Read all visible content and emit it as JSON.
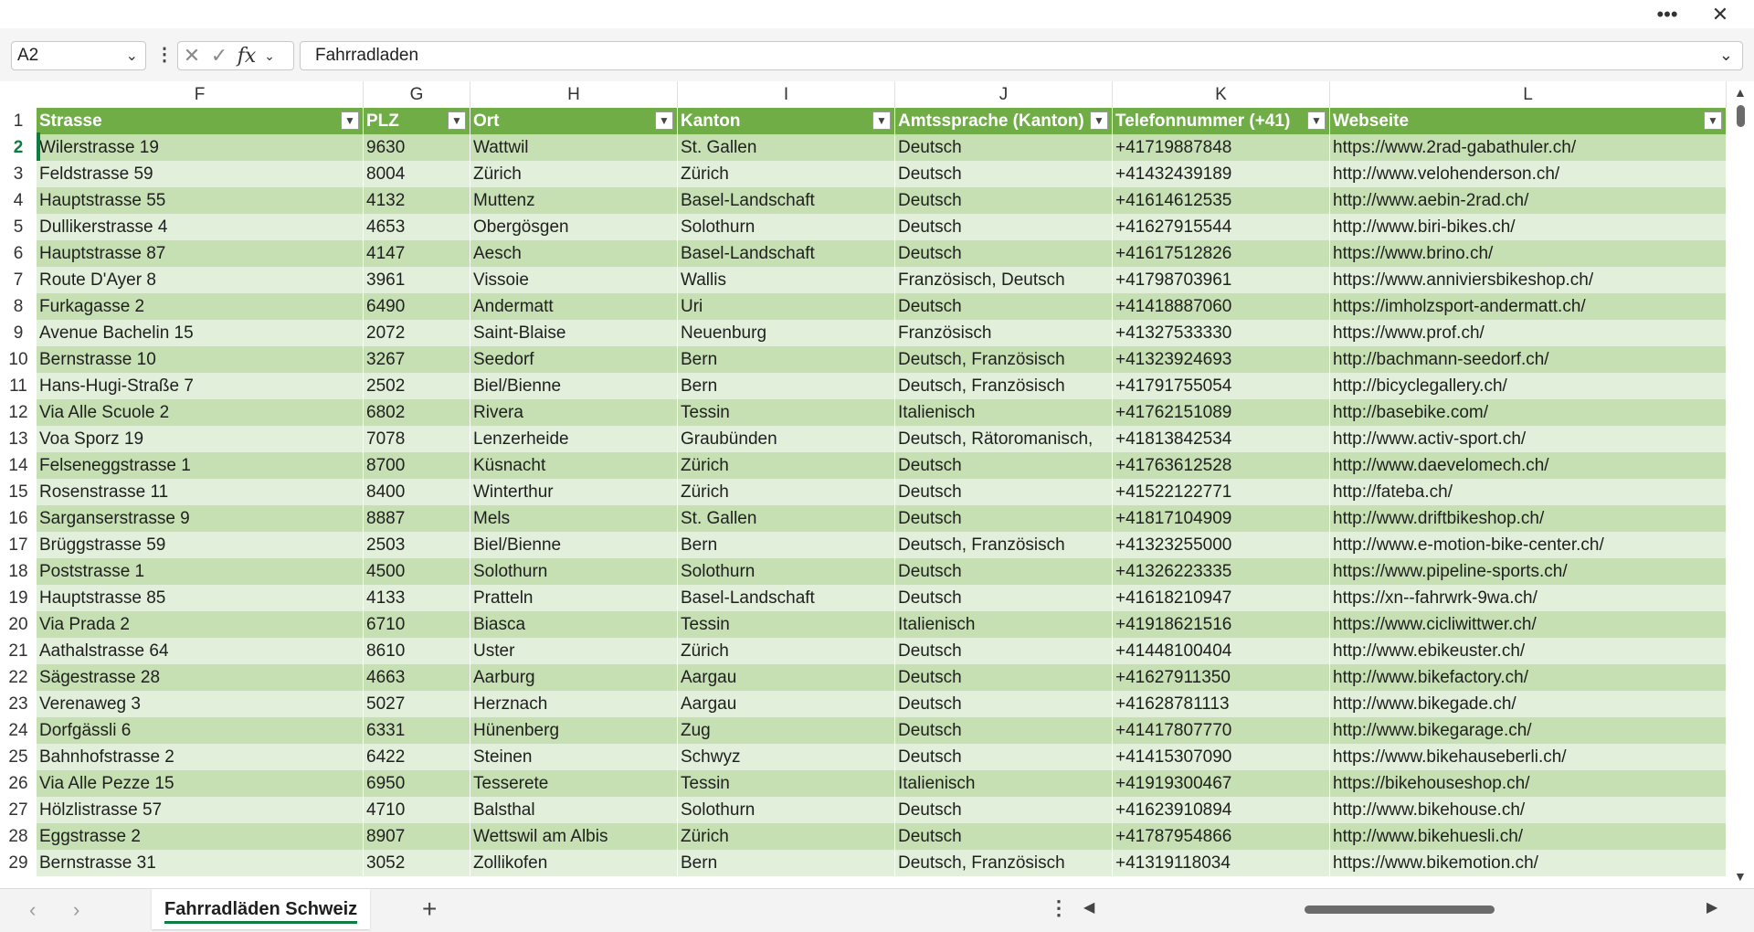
{
  "window": {
    "more_glyph": "•••",
    "close_glyph": "✕"
  },
  "formula_bar": {
    "name_box": "A2",
    "cancel_glyph": "✕",
    "enter_glyph": "✓",
    "fx_label": "fx",
    "content": "Fahrradladen"
  },
  "columns": [
    "F",
    "G",
    "H",
    "I",
    "J",
    "K",
    "L"
  ],
  "header_row_number": "1",
  "headers": [
    "Strasse",
    "PLZ",
    "Ort",
    "Kanton",
    "Amtssprache (Kanton)",
    "Telefonnummer (+41)",
    "Webseite"
  ],
  "rows": [
    {
      "n": "2",
      "c": [
        "Wilerstrasse 19",
        "9630",
        "Wattwil",
        "St. Gallen",
        "Deutsch",
        "+41719887848",
        "https://www.2rad-gabathuler.ch/"
      ]
    },
    {
      "n": "3",
      "c": [
        "Feldstrasse 59",
        "8004",
        "Zürich",
        "Zürich",
        "Deutsch",
        "+41432439189",
        "http://www.velohenderson.ch/"
      ]
    },
    {
      "n": "4",
      "c": [
        "Hauptstrasse 55",
        "4132",
        "Muttenz",
        "Basel-Landschaft",
        "Deutsch",
        "+41614612535",
        "http://www.aebin-2rad.ch/"
      ]
    },
    {
      "n": "5",
      "c": [
        "Dullikerstrasse 4",
        "4653",
        "Obergösgen",
        "Solothurn",
        "Deutsch",
        "+41627915544",
        "http://www.biri-bikes.ch/"
      ]
    },
    {
      "n": "6",
      "c": [
        "Hauptstrasse 87",
        "4147",
        "Aesch",
        "Basel-Landschaft",
        "Deutsch",
        "+41617512826",
        "https://www.brino.ch/"
      ]
    },
    {
      "n": "7",
      "c": [
        "Route D'Ayer 8",
        "3961",
        "Vissoie",
        "Wallis",
        "Französisch, Deutsch",
        "+41798703961",
        "https://www.anniviersbikeshop.ch/"
      ]
    },
    {
      "n": "8",
      "c": [
        "Furkagasse 2",
        "6490",
        "Andermatt",
        "Uri",
        "Deutsch",
        "+41418887060",
        "https://imholzsport-andermatt.ch/"
      ]
    },
    {
      "n": "9",
      "c": [
        "Avenue Bachelin 15",
        "2072",
        "Saint-Blaise",
        "Neuenburg",
        "Französisch",
        "+41327533330",
        "https://www.prof.ch/"
      ]
    },
    {
      "n": "10",
      "c": [
        "Bernstrasse 10",
        "3267",
        "Seedorf",
        "Bern",
        "Deutsch, Französisch",
        "+41323924693",
        "http://bachmann-seedorf.ch/"
      ]
    },
    {
      "n": "11",
      "c": [
        "Hans-Hugi-Straße 7",
        "2502",
        "Biel/Bienne",
        "Bern",
        "Deutsch, Französisch",
        "+41791755054",
        "http://bicyclegallery.ch/"
      ]
    },
    {
      "n": "12",
      "c": [
        "Via Alle Scuole 2",
        "6802",
        "Rivera",
        "Tessin",
        "Italienisch",
        "+41762151089",
        "http://basebike.com/"
      ]
    },
    {
      "n": "13",
      "c": [
        "Voa Sporz 19",
        "7078",
        "Lenzerheide",
        "Graubünden",
        "Deutsch, Rätoromanisch,",
        "+41813842534",
        "http://www.activ-sport.ch/"
      ]
    },
    {
      "n": "14",
      "c": [
        "Felseneggstrasse 1",
        "8700",
        "Küsnacht",
        "Zürich",
        "Deutsch",
        "+41763612528",
        "http://www.daevelomech.ch/"
      ]
    },
    {
      "n": "15",
      "c": [
        "Rosenstrasse 11",
        "8400",
        "Winterthur",
        "Zürich",
        "Deutsch",
        "+41522122771",
        "http://fateba.ch/"
      ]
    },
    {
      "n": "16",
      "c": [
        "Sarganserstrasse 9",
        "8887",
        "Mels",
        "St. Gallen",
        "Deutsch",
        "+41817104909",
        "http://www.driftbikeshop.ch/"
      ]
    },
    {
      "n": "17",
      "c": [
        "Brüggstrasse 59",
        "2503",
        "Biel/Bienne",
        "Bern",
        "Deutsch, Französisch",
        "+41323255000",
        "http://www.e-motion-bike-center.ch/"
      ]
    },
    {
      "n": "18",
      "c": [
        "Poststrasse 1",
        "4500",
        "Solothurn",
        "Solothurn",
        "Deutsch",
        "+41326223335",
        "https://www.pipeline-sports.ch/"
      ]
    },
    {
      "n": "19",
      "c": [
        "Hauptstrasse 85",
        "4133",
        "Pratteln",
        "Basel-Landschaft",
        "Deutsch",
        "+41618210947",
        "https://xn--fahrwrk-9wa.ch/"
      ]
    },
    {
      "n": "20",
      "c": [
        "Via Prada 2",
        "6710",
        "Biasca",
        "Tessin",
        "Italienisch",
        "+41918621516",
        "https://www.cicliwittwer.ch/"
      ]
    },
    {
      "n": "21",
      "c": [
        "Aathalstrasse 64",
        "8610",
        "Uster",
        "Zürich",
        "Deutsch",
        "+41448100404",
        "http://www.ebikeuster.ch/"
      ]
    },
    {
      "n": "22",
      "c": [
        "Sägestrasse 28",
        "4663",
        "Aarburg",
        "Aargau",
        "Deutsch",
        "+41627911350",
        "http://www.bikefactory.ch/"
      ]
    },
    {
      "n": "23",
      "c": [
        "Verenaweg 3",
        "5027",
        "Herznach",
        "Aargau",
        "Deutsch",
        "+41628781113",
        "http://www.bikegade.ch/"
      ]
    },
    {
      "n": "24",
      "c": [
        "Dorfgässli 6",
        "6331",
        "Hünenberg",
        "Zug",
        "Deutsch",
        "+41417807770",
        "http://www.bikegarage.ch/"
      ]
    },
    {
      "n": "25",
      "c": [
        "Bahnhofstrasse 2",
        "6422",
        "Steinen",
        "Schwyz",
        "Deutsch",
        "+41415307090",
        "https://www.bikehauseberli.ch/"
      ]
    },
    {
      "n": "26",
      "c": [
        "Via Alle Pezze 15",
        "6950",
        "Tesserete",
        "Tessin",
        "Italienisch",
        "+41919300467",
        "https://bikehouseshop.ch/"
      ]
    },
    {
      "n": "27",
      "c": [
        "Hölzlistrasse 57",
        "4710",
        "Balsthal",
        "Solothurn",
        "Deutsch",
        "+41623910894",
        "http://www.bikehouse.ch/"
      ]
    },
    {
      "n": "28",
      "c": [
        "Eggstrasse 2",
        "8907",
        "Wettswil am Albis",
        "Zürich",
        "Deutsch",
        "+41787954866",
        "http://www.bikehuesli.ch/"
      ]
    },
    {
      "n": "29",
      "c": [
        "Bernstrasse 31",
        "3052",
        "Zollikofen",
        "Bern",
        "Deutsch, Französisch",
        "+41319118034",
        "https://www.bikemotion.ch/"
      ]
    }
  ],
  "sheet_tabs": {
    "active": "Fahrradläden Schweiz",
    "add_glyph": "+",
    "prev_glyph": "‹",
    "next_glyph": "›"
  },
  "icons": {
    "filter": "chevron-down-icon",
    "more": "more-horizontal-icon",
    "close": "close-icon"
  },
  "colors": {
    "table_header": "#70ad47",
    "band_dark": "#c6e0b4",
    "band_light": "#e2efda",
    "accent": "#107c41"
  }
}
